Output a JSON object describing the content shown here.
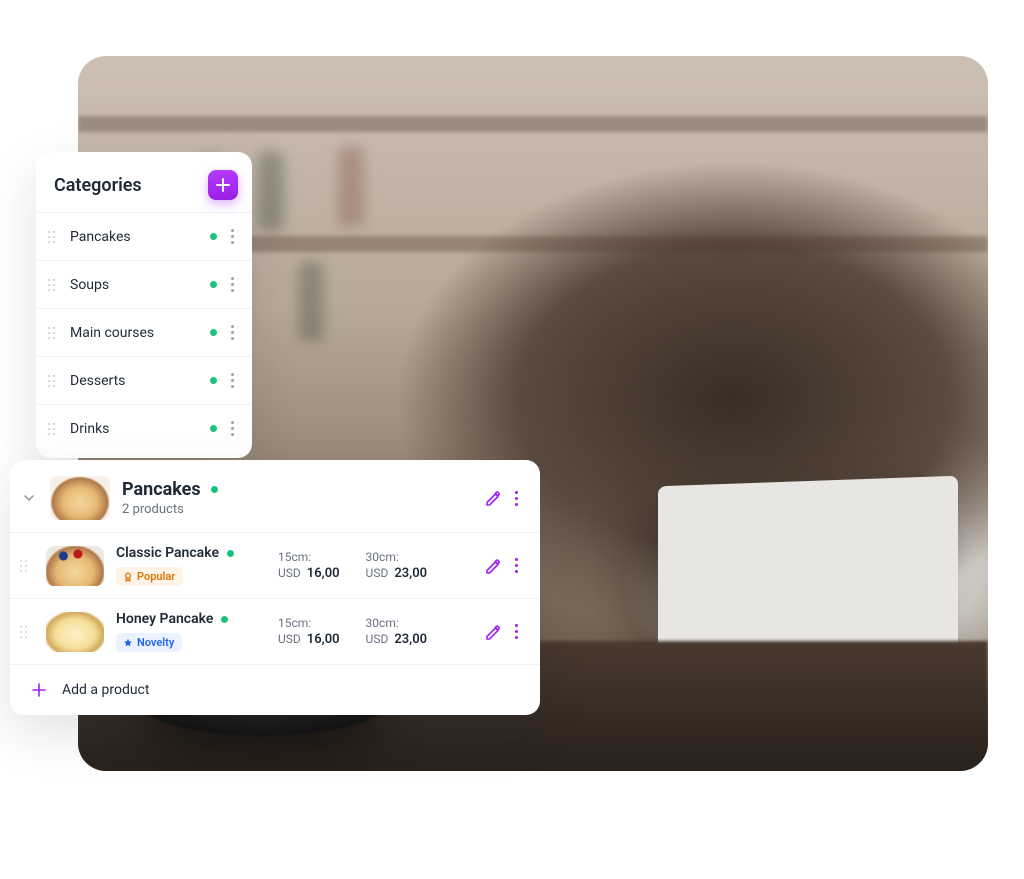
{
  "categories": {
    "title": "Categories",
    "items": [
      {
        "label": "Pancakes"
      },
      {
        "label": "Soups"
      },
      {
        "label": "Main courses"
      },
      {
        "label": "Desserts"
      },
      {
        "label": "Drinks"
      }
    ]
  },
  "products": {
    "group": {
      "title": "Pancakes",
      "subtitle": "2 products"
    },
    "items": [
      {
        "name": "Classic Pancake",
        "badge": {
          "type": "popular",
          "label": "Popular"
        },
        "prices": {
          "a": {
            "size": "15cm:",
            "currency": "USD",
            "value": "16,00"
          },
          "b": {
            "size": "30cm:",
            "currency": "USD",
            "value": "23,00"
          }
        }
      },
      {
        "name": "Honey Pancake",
        "badge": {
          "type": "novelty",
          "label": "Novelty"
        },
        "prices": {
          "a": {
            "size": "15cm:",
            "currency": "USD",
            "value": "16,00"
          },
          "b": {
            "size": "30cm:",
            "currency": "USD",
            "value": "23,00"
          }
        }
      }
    ],
    "add_label": "Add a product"
  },
  "colors": {
    "accent": "#B53AFF",
    "status_green": "#19c37d"
  }
}
